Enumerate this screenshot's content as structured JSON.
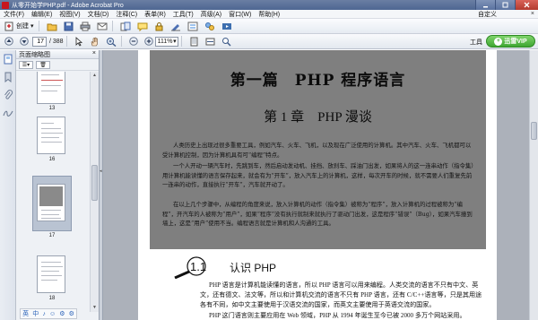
{
  "window": {
    "title": "从零开始学PHP.pdf - Adobe Acrobat Pro",
    "controls": [
      "minimize",
      "maximize",
      "close"
    ]
  },
  "menu": {
    "items": [
      "文件(F)",
      "编辑(E)",
      "视图(V)",
      "文档(D)",
      "注释(C)",
      "表单(R)",
      "工具(T)",
      "高级(A)",
      "窗口(W)",
      "帮助(H)"
    ],
    "customize_label": "自定义",
    "close_glyph": "×"
  },
  "toolbar1": {
    "create_label": "创建",
    "icons": [
      "create-icon",
      "open-folder-icon",
      "save-icon",
      "print-icon",
      "email-icon",
      "comment-icon",
      "secure-icon",
      "sign-icon",
      "form-icon",
      "review-icon",
      "tools-icon"
    ]
  },
  "toolbar2": {
    "page_current": "17",
    "page_total": "/ 388",
    "zoom": "111%",
    "tools_label": "工具",
    "vip_label": "迅雷VIP",
    "vip_badge": "+"
  },
  "panel": {
    "title": "页面缩略图",
    "close": "×",
    "thumbnails": [
      {
        "label": "13"
      },
      {
        "label": "16"
      },
      {
        "label": "17"
      },
      {
        "label": "18"
      }
    ],
    "taskbar": [
      "英",
      "中",
      "♪",
      "☺",
      "⚙",
      "⚙"
    ]
  },
  "document": {
    "part_title": "第一篇　PHP 程序语言",
    "chapter_title": "第 1 章　PHP 漫谈",
    "scan_paragraphs": [
      "人类历史上出现过很多重要工具，例如汽车、火车、飞机，以及现在广泛使用的计算机。其中汽车、火车、飞机都可以受计算机控制，因为计算机具有可“编程”特点。",
      "一个人开动一辆汽车时，先跳到车，然后启动发动机、挂挡、放刹车、踩油门出发，如果将人的这一连串动作（指令集）用计算机能读懂的语言保存起来，就会有为“开车”，放入汽车上的计算机，这样，每次开车的时候，就不需要人们重复先前一连串的动作，直接执行“开车”，汽车就开动了。",
      "在以上几个步骤中，从编程的角度来说，放入计算机的动作（指令集）被称为“程序”，放入计算机的过程被称为“编程”，开汽车的人被称为“用户”，如果“程序”没有执行就制来就执行了驱动门出发，这是程序“错误”（Bug），如果汽车撞到墙上，这是“用户”使用不当。编程语言就是计算机和人沟通的工具。"
    ],
    "section_number": "1.1",
    "section_title": "认识 PHP",
    "body_paragraphs": [
      "PHP 语言是计算机能读懂的语言，所以 PHP 语言可以用来编程。人类交流的语言不只有中文、英文，还有德文、法文等，所以和计算机交流的语言不只有 PHP 语言，还有 C/C++语言等，只是其用途各有不同，如中文主要使用于汉语交流的国家，而英文主要使用于英语交流的国家。",
      "PHP 这门语言则主要应用在 Web 领域，PHP 从 1994 年诞生至今已被 2000 多万个网站采用。"
    ]
  },
  "colors": {
    "titlebar": "#4e6792",
    "scan_gray": "#7f7f7f",
    "doc_background": "#acb1ba",
    "vip_green": "#3fa632"
  }
}
